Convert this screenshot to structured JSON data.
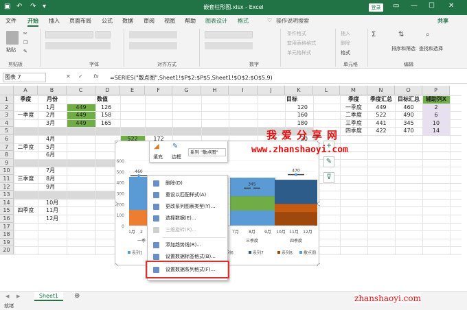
{
  "window": {
    "title": "嵌套柱形图.xlsx  -  Excel",
    "login": "登录"
  },
  "tabs": [
    "文件",
    "开始",
    "插入",
    "页面布局",
    "公式",
    "数据",
    "审阅",
    "视图",
    "帮助",
    "图表设计",
    "格式"
  ],
  "tell_me": "操作说明搜索",
  "share": "共享",
  "ribbon": {
    "groups": {
      "clipboard": "剪贴板",
      "font": "字体",
      "align": "对齐方式",
      "number": "数字",
      "cells": "单元格",
      "editing": "编辑"
    },
    "paste": "粘贴",
    "styles": [
      "条件格式",
      "套用表格格式",
      "单元格样式"
    ],
    "cells_btns": [
      "插入",
      "删除",
      "格式"
    ],
    "sort": "排序和筛选",
    "find": "查找和选择"
  },
  "formula_bar": {
    "name_box": "图表 7",
    "fx": "fx",
    "formula": "=SERIES(\"散点图\",Sheet1!$P$2:$P$5,Sheet1!$O$2:$O$5,9)"
  },
  "columns": [
    "A",
    "B",
    "C",
    "D",
    "E",
    "F",
    "G",
    "H",
    "I",
    "J",
    "K",
    "L",
    "M",
    "N",
    "O",
    "P"
  ],
  "rows": [
    "1",
    "2",
    "3",
    "4",
    "5",
    "6",
    "7",
    "8",
    "9",
    "10",
    "11",
    "12",
    "13",
    "14",
    "15",
    "16",
    "17",
    "18",
    "19",
    "20"
  ],
  "table1": {
    "headers": {
      "season": "季度",
      "month": "月份",
      "value": "数值",
      "target": "目标"
    },
    "seasons": [
      "一季度",
      "二季度",
      "三季度",
      "四季度"
    ],
    "months": [
      "1月",
      "2月",
      "3月",
      "4月",
      "5月",
      "6月",
      "7月",
      "8月",
      "9月",
      "10月",
      "11月",
      "12月"
    ],
    "c_vals": [
      "449",
      "449",
      "449"
    ],
    "d_vals": [
      "126",
      "158",
      "165"
    ],
    "k_vals": [
      "120",
      "160",
      "180"
    ],
    "k_partial": "20",
    "e6": "522",
    "f6": "172"
  },
  "table2": {
    "headers": [
      "季度",
      "季度汇总",
      "目标汇总",
      "辅助列X"
    ],
    "rows": [
      [
        "一季度",
        "449",
        "460",
        "2"
      ],
      [
        "二季度",
        "522",
        "490",
        "6"
      ],
      [
        "三季度",
        "441",
        "345",
        "10"
      ],
      [
        "四季度",
        "422",
        "470",
        "14"
      ]
    ]
  },
  "chart": {
    "yticks": [
      "600",
      "500",
      "400",
      "300",
      "200",
      "100",
      "0"
    ],
    "bar_labels": [
      "460",
      "345",
      "470"
    ],
    "axis_labels": [
      "1月",
      "2",
      "7月",
      "8月",
      "9月",
      "10月",
      "11月",
      "12月"
    ],
    "group_labels": [
      "一季",
      "三季度",
      "四季度"
    ],
    "legend": [
      "系列1",
      "系列6",
      "系列7",
      "系列8",
      "散点图"
    ],
    "legend_partial": "系列"
  },
  "minibar": {
    "fill": "填充",
    "border": "边框",
    "series_select": "系列 \"散点图\""
  },
  "context_menu": [
    {
      "label": "删除(D)",
      "disabled": false
    },
    {
      "label": "重设以匹配样式(A)",
      "disabled": false
    },
    {
      "label": "更改系列图表类型(Y)...",
      "disabled": false
    },
    {
      "label": "选择数据(E)...",
      "disabled": false
    },
    {
      "label": "三维旋转(R)...",
      "disabled": true
    },
    {
      "label": "添加趋势线(R)...",
      "disabled": false
    },
    {
      "label": "设置数据标签格式(B)...",
      "disabled": false
    },
    {
      "label": "设置数据系列格式(F)...",
      "disabled": false
    }
  ],
  "sheet_tab": "Sheet1",
  "status": "就绪",
  "watermark": {
    "line1": "我爱分享网",
    "line2": "www.zhanshaoyi.com",
    "line3": "zhanshaoyi.com"
  },
  "colors": {
    "excel_green": "#217346",
    "fill_green": "#70ad47",
    "bar_blue": "#5b9bd5",
    "bar_orange": "#ed7d31",
    "bar_dark": "#2e5c8a",
    "bar_brown": "#9e480e",
    "watermark_red": "#e01010"
  }
}
